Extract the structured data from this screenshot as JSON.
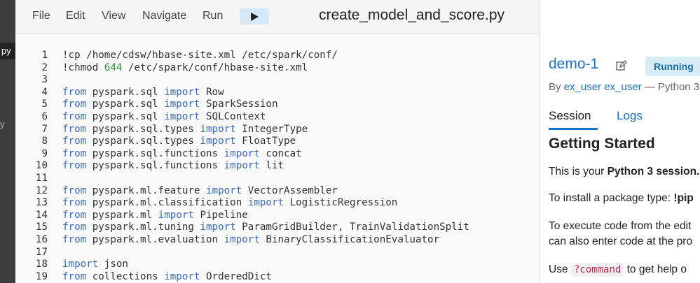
{
  "sidebar": {
    "active_label": "py",
    "item2_label": "y"
  },
  "toolbar": {
    "menus": [
      "File",
      "Edit",
      "View",
      "Navigate",
      "Run"
    ],
    "run_icon": "play-icon",
    "filename": "create_model_and_score.py"
  },
  "editor": {
    "lines": [
      {
        "n": "1",
        "code": [
          {
            "t": "!cp /home/cdsw/hbase-site.xml /etc/spark/conf/"
          }
        ]
      },
      {
        "n": "2",
        "code": [
          {
            "t": "!chmod "
          },
          {
            "t": "644",
            "c": "num"
          },
          {
            "t": " /etc/spark/conf/hbase-site.xml"
          }
        ]
      },
      {
        "n": "3",
        "code": []
      },
      {
        "n": "4",
        "code": [
          {
            "t": "from",
            "c": "kw"
          },
          {
            "t": " pyspark.sql "
          },
          {
            "t": "import",
            "c": "kw"
          },
          {
            "t": " Row"
          }
        ]
      },
      {
        "n": "5",
        "code": [
          {
            "t": "from",
            "c": "kw"
          },
          {
            "t": " pyspark.sql "
          },
          {
            "t": "import",
            "c": "kw"
          },
          {
            "t": " SparkSession"
          }
        ]
      },
      {
        "n": "6",
        "code": [
          {
            "t": "from",
            "c": "kw"
          },
          {
            "t": " pyspark.sql "
          },
          {
            "t": "import",
            "c": "kw"
          },
          {
            "t": " SQLContext"
          }
        ]
      },
      {
        "n": "7",
        "code": [
          {
            "t": "from",
            "c": "kw"
          },
          {
            "t": " pyspark.sql.types "
          },
          {
            "t": "import",
            "c": "kw"
          },
          {
            "t": " IntegerType"
          }
        ]
      },
      {
        "n": "8",
        "code": [
          {
            "t": "from",
            "c": "kw"
          },
          {
            "t": " pyspark.sql.types "
          },
          {
            "t": "import",
            "c": "kw"
          },
          {
            "t": " FloatType"
          }
        ]
      },
      {
        "n": "9",
        "code": [
          {
            "t": "from",
            "c": "kw"
          },
          {
            "t": " pyspark.sql.functions "
          },
          {
            "t": "import",
            "c": "kw"
          },
          {
            "t": " concat"
          }
        ]
      },
      {
        "n": "10",
        "code": [
          {
            "t": "from",
            "c": "kw"
          },
          {
            "t": " pyspark.sql.functions "
          },
          {
            "t": "import",
            "c": "kw"
          },
          {
            "t": " lit"
          }
        ]
      },
      {
        "n": "11",
        "code": []
      },
      {
        "n": "12",
        "code": [
          {
            "t": "from",
            "c": "kw"
          },
          {
            "t": " pyspark.ml.feature "
          },
          {
            "t": "import",
            "c": "kw"
          },
          {
            "t": " VectorAssembler"
          }
        ]
      },
      {
        "n": "13",
        "code": [
          {
            "t": "from",
            "c": "kw"
          },
          {
            "t": " pyspark.ml.classification "
          },
          {
            "t": "import",
            "c": "kw"
          },
          {
            "t": " LogisticRegression"
          }
        ]
      },
      {
        "n": "14",
        "code": [
          {
            "t": "from",
            "c": "kw"
          },
          {
            "t": " pyspark.ml "
          },
          {
            "t": "import",
            "c": "kw"
          },
          {
            "t": " Pipeline"
          }
        ]
      },
      {
        "n": "15",
        "code": [
          {
            "t": "from",
            "c": "kw"
          },
          {
            "t": " pyspark.ml.tuning "
          },
          {
            "t": "import",
            "c": "kw"
          },
          {
            "t": " ParamGridBuilder, TrainValidationSplit"
          }
        ]
      },
      {
        "n": "16",
        "code": [
          {
            "t": "from",
            "c": "kw"
          },
          {
            "t": " pyspark.ml.evaluation "
          },
          {
            "t": "import",
            "c": "kw"
          },
          {
            "t": " BinaryClassificationEvaluator"
          }
        ]
      },
      {
        "n": "17",
        "code": []
      },
      {
        "n": "18",
        "code": [
          {
            "t": "import",
            "c": "kw"
          },
          {
            "t": " json"
          }
        ]
      },
      {
        "n": "19",
        "code": [
          {
            "t": "from",
            "c": "kw"
          },
          {
            "t": " collections "
          },
          {
            "t": "import",
            "c": "kw"
          },
          {
            "t": " OrderedDict"
          }
        ]
      }
    ]
  },
  "session": {
    "name": "demo-1",
    "status": "Running",
    "by_prefix": "By ",
    "user": "ex_user ex_user",
    "by_suffix": " — Python 3",
    "tabs": [
      "Session",
      "Logs"
    ],
    "heading": "Getting Started",
    "p1_pre": "This is your ",
    "p1_bold": "Python 3 session.",
    "p2_pre": "To install a package type: ",
    "p2_bold": "!pip",
    "p3_line1": "To execute code from the edit",
    "p3_line2": "can also enter code at the pro",
    "p4_pre": "Use ",
    "p4_code": "?command",
    "p4_post": " to get help o"
  },
  "colors": {
    "accent": "#1f6fc0",
    "keyword": "#3b6bbb",
    "number": "#2f8f3f",
    "status_bg": "#d7ecf7"
  }
}
